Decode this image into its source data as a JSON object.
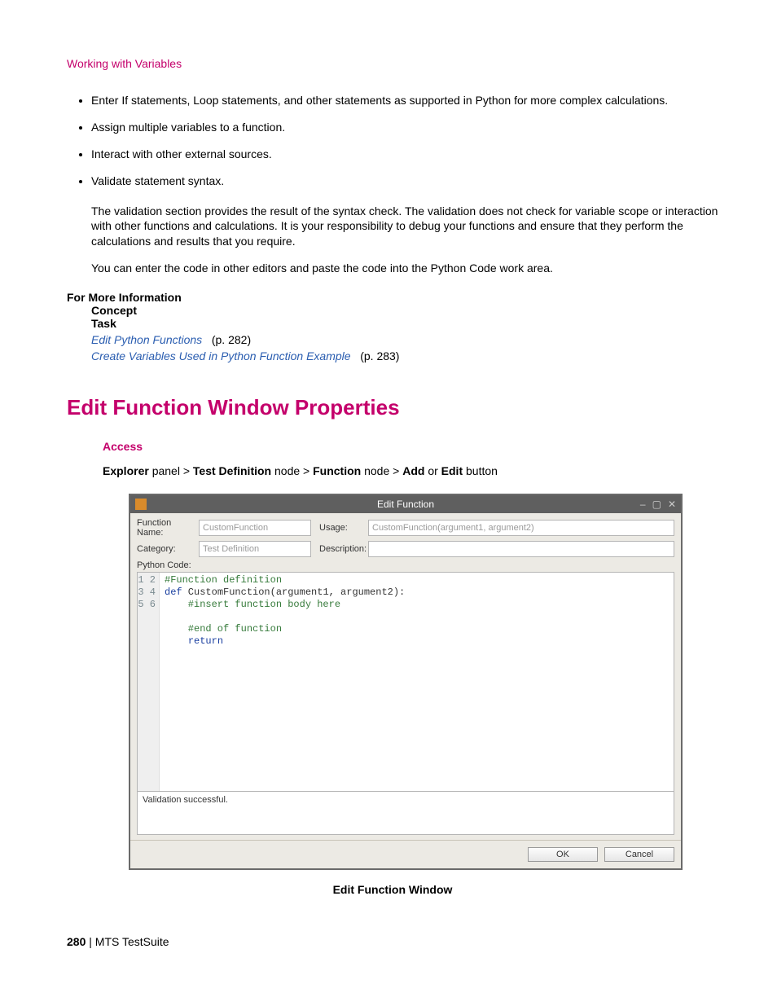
{
  "header_link": "Working with Variables",
  "bullets": [
    "Enter If statements, Loop statements, and other statements as supported in Python for more complex calculations.",
    "Assign multiple variables to a function.",
    "Interact with other external sources.",
    "Validate statement syntax."
  ],
  "para1": "The validation section provides the result of the syntax check. The validation does not check for variable scope or interaction with other functions and calculations. It is your responsibility to debug your functions and ensure that they perform the calculations and results that you require.",
  "para2": "You can enter the code in other editors and paste the code into the Python Code work area.",
  "fmi": {
    "title": "For More Information",
    "concept": "Concept",
    "task": "Task",
    "links": [
      {
        "text": "Edit Python Functions",
        "page": "(p. 282)"
      },
      {
        "text": "Create Variables Used in Python Function Example",
        "page": "(p. 283)"
      }
    ]
  },
  "section_title": "Edit Function Window Properties",
  "access_label": "Access",
  "breadcrumb": {
    "p1b": "Explorer",
    "p1": " panel > ",
    "p2b": "Test Definition",
    "p2": " node > ",
    "p3b": "Function",
    "p3": " node > ",
    "p4b": "Add",
    "p4mid": " or ",
    "p5b": "Edit",
    "p5": " button"
  },
  "dialog": {
    "title": "Edit Function",
    "labels": {
      "function_name": "Function Name:",
      "usage": "Usage:",
      "category": "Category:",
      "description": "Description:",
      "python_code": "Python Code:"
    },
    "values": {
      "function_name": "CustomFunction",
      "usage": "CustomFunction(argument1, argument2)",
      "category": "Test Definition",
      "description": ""
    },
    "gutter": "1\n2\n3\n4\n5\n6",
    "code": {
      "l1": "#Function definition",
      "l2a": "def",
      "l2b": " CustomFunction(argument1, argument2):",
      "l3": "    #insert function body here",
      "l4": "",
      "l5": "    #end of function",
      "l6a": "    ",
      "l6b": "return"
    },
    "validation": "Validation successful.",
    "buttons": {
      "ok": "OK",
      "cancel": "Cancel"
    }
  },
  "fig_caption": "Edit Function Window",
  "footer": {
    "page": "280",
    "sep": " | ",
    "product": "MTS TestSuite"
  }
}
